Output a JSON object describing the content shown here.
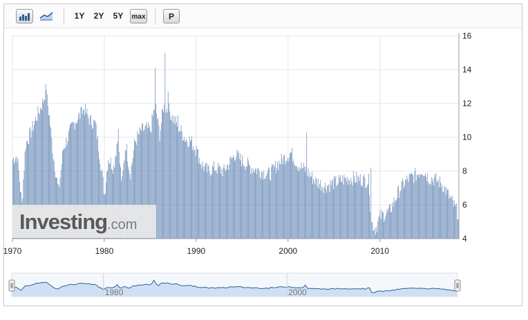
{
  "toolbar": {
    "bar_icon": "bar-chart-icon",
    "line_icon": "line-chart-icon",
    "ranges": [
      "1Y",
      "2Y",
      "5Y",
      "max"
    ],
    "p_label": "P"
  },
  "logo": {
    "main": "Investing",
    "domain": ".com"
  },
  "colors": {
    "bar": "#6f8fba",
    "bar_edge": "#3f5f8f",
    "navigator_fill": "#cfe0f5",
    "navigator_line": "#2f5f96"
  },
  "chart_data": {
    "type": "bar",
    "xlim": [
      1970,
      2018.6
    ],
    "ylim": [
      4,
      16
    ],
    "y_ticks": [
      "4",
      "6",
      "8",
      "10",
      "12",
      "14",
      "16"
    ],
    "x_ticks": [
      {
        "value": 1970,
        "label": "1970"
      },
      {
        "value": 1980,
        "label": "1980"
      },
      {
        "value": 1990,
        "label": "1990"
      },
      {
        "value": 2000,
        "label": "2000"
      },
      {
        "value": 2010,
        "label": "2010"
      }
    ],
    "navigator_ticks": [
      {
        "value": 1980,
        "label": "1980"
      },
      {
        "value": 2000,
        "label": "2000"
      }
    ],
    "grid": true,
    "legend": "none",
    "series_anchors": [
      [
        1970.0,
        8.7
      ],
      [
        1970.5,
        8.9
      ],
      [
        1971.0,
        6.0
      ],
      [
        1971.4,
        9.6
      ],
      [
        1972.0,
        10.3
      ],
      [
        1972.6,
        11.2
      ],
      [
        1973.3,
        12.1
      ],
      [
        1973.6,
        12.8
      ],
      [
        1974.0,
        11.2
      ],
      [
        1974.4,
        9.0
      ],
      [
        1975.0,
        6.8
      ],
      [
        1975.5,
        9.3
      ],
      [
        1976.0,
        10.0
      ],
      [
        1976.6,
        10.8
      ],
      [
        1977.2,
        11.2
      ],
      [
        1977.8,
        11.7
      ],
      [
        1978.4,
        11.0
      ],
      [
        1979.0,
        10.8
      ],
      [
        1979.5,
        8.8
      ],
      [
        1980.0,
        6.6
      ],
      [
        1980.4,
        8.8
      ],
      [
        1981.0,
        8.2
      ],
      [
        1981.4,
        9.9
      ],
      [
        1981.9,
        7.2
      ],
      [
        1982.3,
        9.7
      ],
      [
        1982.8,
        7.8
      ],
      [
        1983.3,
        9.7
      ],
      [
        1984.0,
        10.4
      ],
      [
        1984.6,
        10.5
      ],
      [
        1985.0,
        10.4
      ],
      [
        1985.5,
        12.0
      ],
      [
        1986.0,
        10.2
      ],
      [
        1986.4,
        11.8
      ],
      [
        1987.0,
        11.6
      ],
      [
        1987.6,
        11.0
      ],
      [
        1988.2,
        10.5
      ],
      [
        1988.8,
        9.9
      ],
      [
        1989.4,
        9.8
      ],
      [
        1990.0,
        9.2
      ],
      [
        1990.6,
        8.4
      ],
      [
        1991.2,
        8.0
      ],
      [
        1992.0,
        8.2
      ],
      [
        1993.0,
        8.0
      ],
      [
        1993.6,
        8.5
      ],
      [
        1994.2,
        9.0
      ],
      [
        1995.0,
        8.6
      ],
      [
        1996.0,
        8.2
      ],
      [
        1997.0,
        8.0
      ],
      [
        1998.0,
        7.8
      ],
      [
        1998.8,
        8.4
      ],
      [
        1999.6,
        8.8
      ],
      [
        2000.3,
        9.1
      ],
      [
        2001.0,
        8.4
      ],
      [
        2002.0,
        8.0
      ],
      [
        2003.0,
        7.4
      ],
      [
        2004.0,
        7.1
      ],
      [
        2005.0,
        7.3
      ],
      [
        2006.0,
        7.5
      ],
      [
        2007.0,
        7.6
      ],
      [
        2008.0,
        7.5
      ],
      [
        2008.8,
        7.4
      ],
      [
        2009.0,
        5.0
      ],
      [
        2009.5,
        4.6
      ],
      [
        2010.0,
        5.3
      ],
      [
        2011.0,
        5.6
      ],
      [
        2011.6,
        6.3
      ],
      [
        2012.2,
        7.0
      ],
      [
        2013.0,
        7.5
      ],
      [
        2014.0,
        7.8
      ],
      [
        2014.6,
        8.1
      ],
      [
        2015.3,
        7.6
      ],
      [
        2016.0,
        7.5
      ],
      [
        2016.8,
        7.2
      ],
      [
        2017.4,
        6.6
      ],
      [
        2018.0,
        6.0
      ],
      [
        2018.6,
        5.4
      ]
    ],
    "spikes": [
      [
        1973.7,
        12.8
      ],
      [
        1985.5,
        14.1
      ],
      [
        1986.6,
        15.0
      ],
      [
        1986.9,
        12.7
      ],
      [
        1988.0,
        11.3
      ],
      [
        2002.0,
        10.3
      ],
      [
        2009.0,
        8.2
      ],
      [
        1977.5,
        11.8
      ],
      [
        1981.5,
        10.5
      ],
      [
        1990.0,
        9.5
      ]
    ]
  }
}
